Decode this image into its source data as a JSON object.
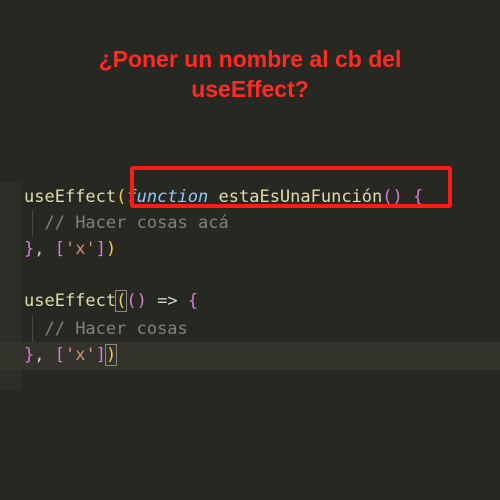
{
  "headline": {
    "line1": "¿Poner un nombre al cb del",
    "line2": "useEffect?"
  },
  "code": {
    "block1": {
      "call_name": "useEffect",
      "open_paren": "(",
      "keyword": "function",
      "fn_name": "estaEsUnaFunción",
      "params": "()",
      "open_brace": "{",
      "comment": "// Hacer cosas acá",
      "close_brace": "}",
      "deps_sep": ", ",
      "deps_open": "[",
      "deps_value": "'x'",
      "deps_close": "]",
      "close_paren": ")"
    },
    "block2": {
      "call_name": "useEffect",
      "open_paren": "(",
      "params": "()",
      "arrow": "=>",
      "open_brace": "{",
      "comment": "// Hacer cosas",
      "close_brace": "}",
      "deps_sep": ", ",
      "deps_open": "[",
      "deps_value": "'x'",
      "deps_close": "]",
      "close_paren": ")"
    }
  },
  "colors": {
    "background": "#282822",
    "headline": "#ff2a24",
    "highlight_box": "#ff1a1a",
    "function_name": "#dcdcaa",
    "keyword": "#8ec7ff",
    "string": "#ce9178",
    "comment": "#7f8080"
  }
}
